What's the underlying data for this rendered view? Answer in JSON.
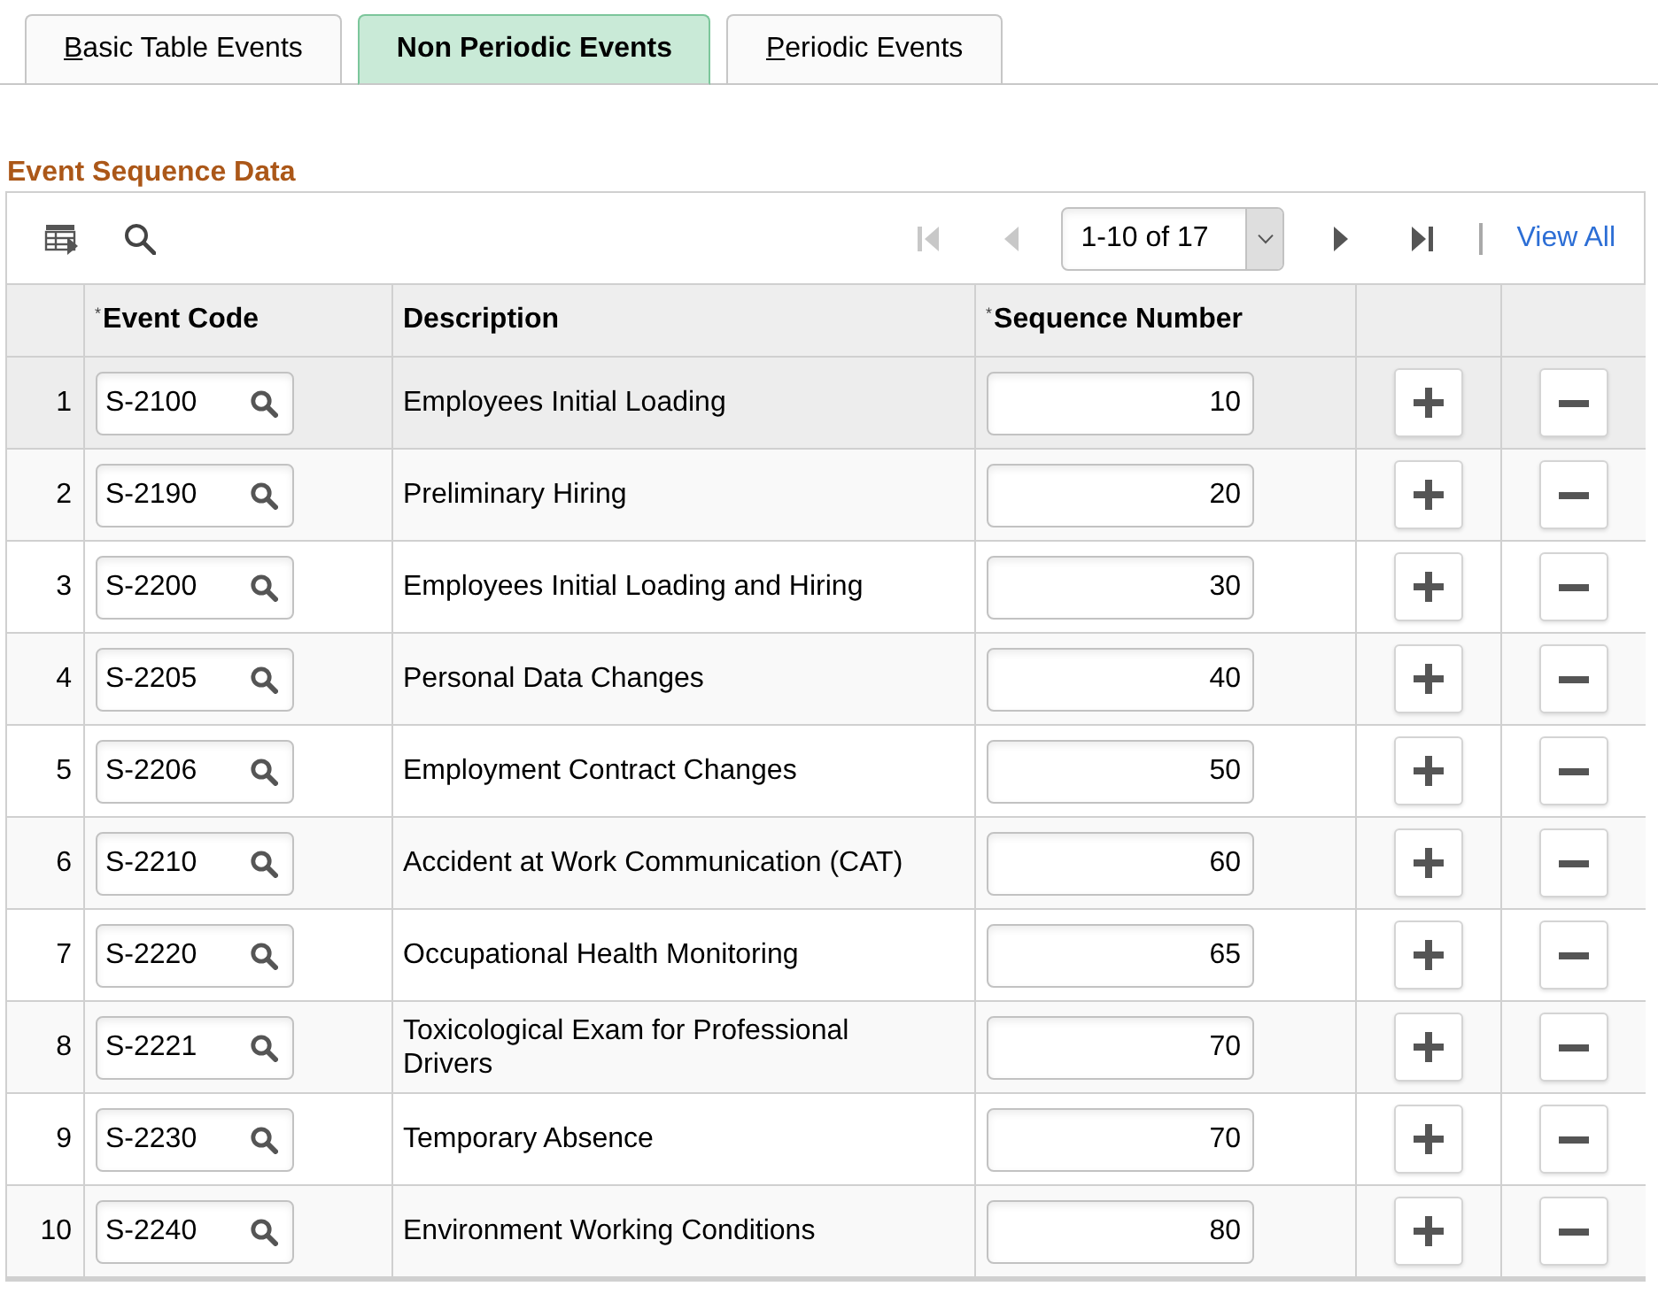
{
  "tabs": [
    {
      "label": "Basic Table Events",
      "selected": false,
      "access_key_underlined": true
    },
    {
      "label": "Non Periodic Events",
      "selected": true,
      "access_key_underlined": false
    },
    {
      "label": "Periodic Events",
      "selected": false,
      "access_key_underlined": true
    }
  ],
  "section": {
    "title": "Event Sequence Data"
  },
  "toolbar": {
    "nav_buttons": [
      {
        "kind": "first",
        "disabled": true
      },
      {
        "kind": "previous",
        "disabled": true
      }
    ],
    "range": "1-10 of 17",
    "nav_buttons_after": [
      {
        "kind": "next",
        "disabled": false
      },
      {
        "kind": "last",
        "disabled": false
      }
    ],
    "view_all": "View All"
  },
  "columns": [
    {
      "label": "Event Code",
      "required_mark": "*"
    },
    {
      "label": "Description"
    },
    {
      "label": "Sequence Number",
      "required_mark": "*"
    }
  ],
  "rows": [
    {
      "number": "1",
      "event_code": "S-2100",
      "description": "Employees Initial Loading",
      "sequence": "10",
      "selected": true
    },
    {
      "number": "2",
      "event_code": "S-2190",
      "description": "Preliminary Hiring",
      "sequence": "20",
      "selected": false
    },
    {
      "number": "3",
      "event_code": "S-2200",
      "description": "Employees Initial Loading and Hiring",
      "sequence": "30",
      "selected": false
    },
    {
      "number": "4",
      "event_code": "S-2205",
      "description": "Personal Data Changes",
      "sequence": "40",
      "selected": false
    },
    {
      "number": "5",
      "event_code": "S-2206",
      "description": "Employment Contract Changes",
      "sequence": "50",
      "selected": false
    },
    {
      "number": "6",
      "event_code": "S-2210",
      "description": "Accident at Work Communication (CAT)",
      "sequence": "60",
      "selected": false
    },
    {
      "number": "7",
      "event_code": "S-2220",
      "description": "Occupational Health Monitoring",
      "sequence": "65",
      "selected": false
    },
    {
      "number": "8",
      "event_code": "S-2221",
      "description": "Toxicological Exam for Professional Drivers",
      "sequence": "70",
      "selected": false
    },
    {
      "number": "9",
      "event_code": "S-2230",
      "description": "Temporary Absence",
      "sequence": "70",
      "selected": false
    },
    {
      "number": "10",
      "event_code": "S-2240",
      "description": "Environment Working Conditions",
      "sequence": "80",
      "selected": false
    }
  ]
}
